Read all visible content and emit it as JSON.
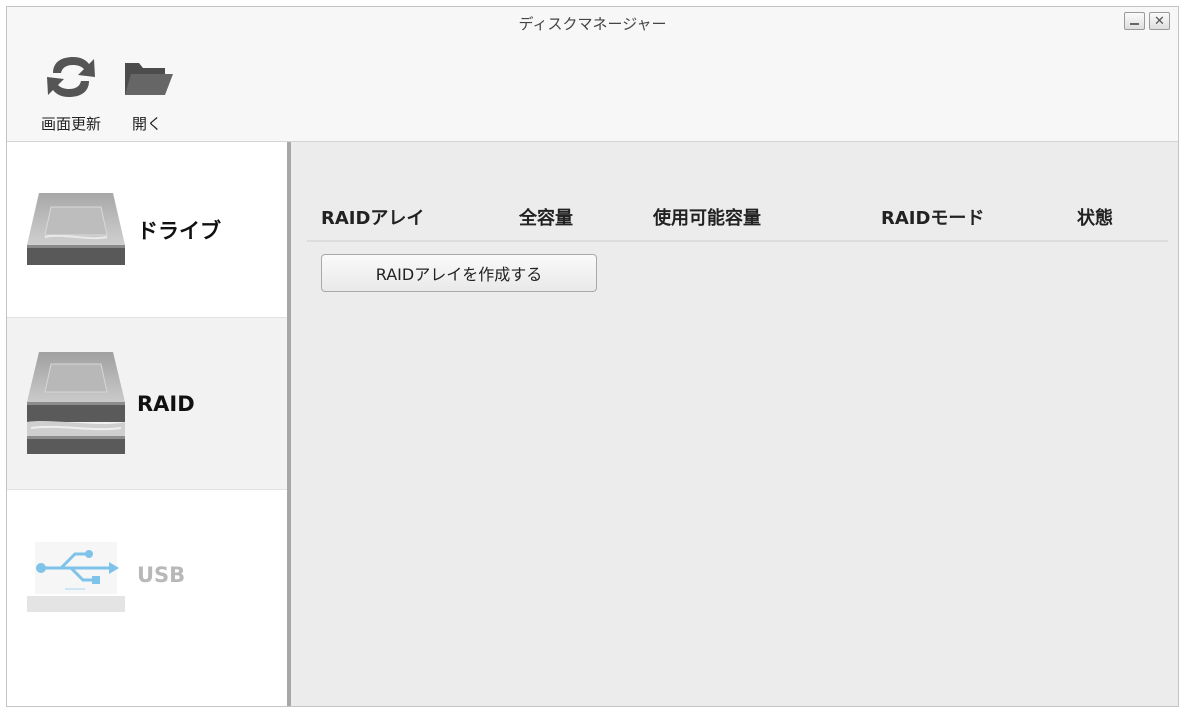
{
  "window": {
    "title": "ディスクマネージャー",
    "close_glyph": "✕"
  },
  "toolbar": {
    "refresh_label": "画面更新",
    "open_label": "開く"
  },
  "sidebar": {
    "items": [
      {
        "label": "ドライブ",
        "icon": "hard-drive-icon",
        "state": "normal"
      },
      {
        "label": "RAID",
        "icon": "raid-drives-icon",
        "state": "selected"
      },
      {
        "label": "USB",
        "icon": "usb-icon",
        "state": "disabled"
      }
    ]
  },
  "table": {
    "columns": [
      "RAIDアレイ",
      "全容量",
      "使用可能容量",
      "RAIDモード",
      "状態"
    ]
  },
  "actions": {
    "create_raid_label": "RAIDアレイを作成する"
  },
  "colors": {
    "disabled_text": "#b8b8b8",
    "content_bg": "#ececec",
    "usb_blue": "#7fc3ea"
  }
}
